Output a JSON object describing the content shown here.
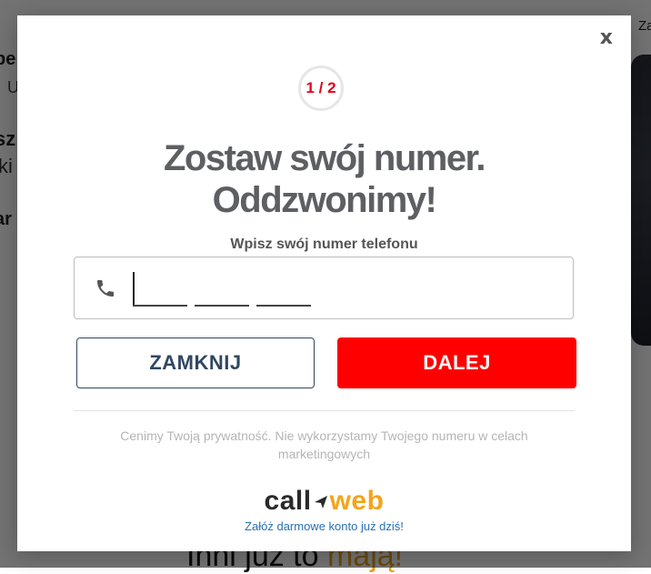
{
  "background": {
    "frag1": "be",
    "frag2": "U",
    "frag3": "sz",
    "frag4": "ki",
    "frag5": "ar",
    "frag6": "Za",
    "bottom_a": "Inni już to ",
    "bottom_b": "mają!"
  },
  "modal": {
    "close_label": "x",
    "step": "1 / 2",
    "title_line1": "Zostaw swój numer.",
    "title_line2": "Oddzwonimy!",
    "subtitle": "Wpisz swój numer telefonu",
    "phone": {
      "value": "",
      "placeholder": ""
    },
    "close_button": "ZAMKNIJ",
    "next_button": "DALEJ",
    "privacy": "Cenimy Twoją prywatność. Nie wykorzystamy Twojego numeru w celach marketingowych",
    "brand_a": "call",
    "brand_b": "web",
    "signup_link": "Załóż darmowe konto już dziś!",
    "colors": {
      "accent": "#e4001b",
      "primary_button": "#ff0000",
      "secondary_border": "#314762",
      "brand_orange": "#f4a41a",
      "link": "#2a6fb5"
    },
    "icons": {
      "phone": "phone-icon",
      "brand_arrow": "arrow-icon"
    }
  }
}
